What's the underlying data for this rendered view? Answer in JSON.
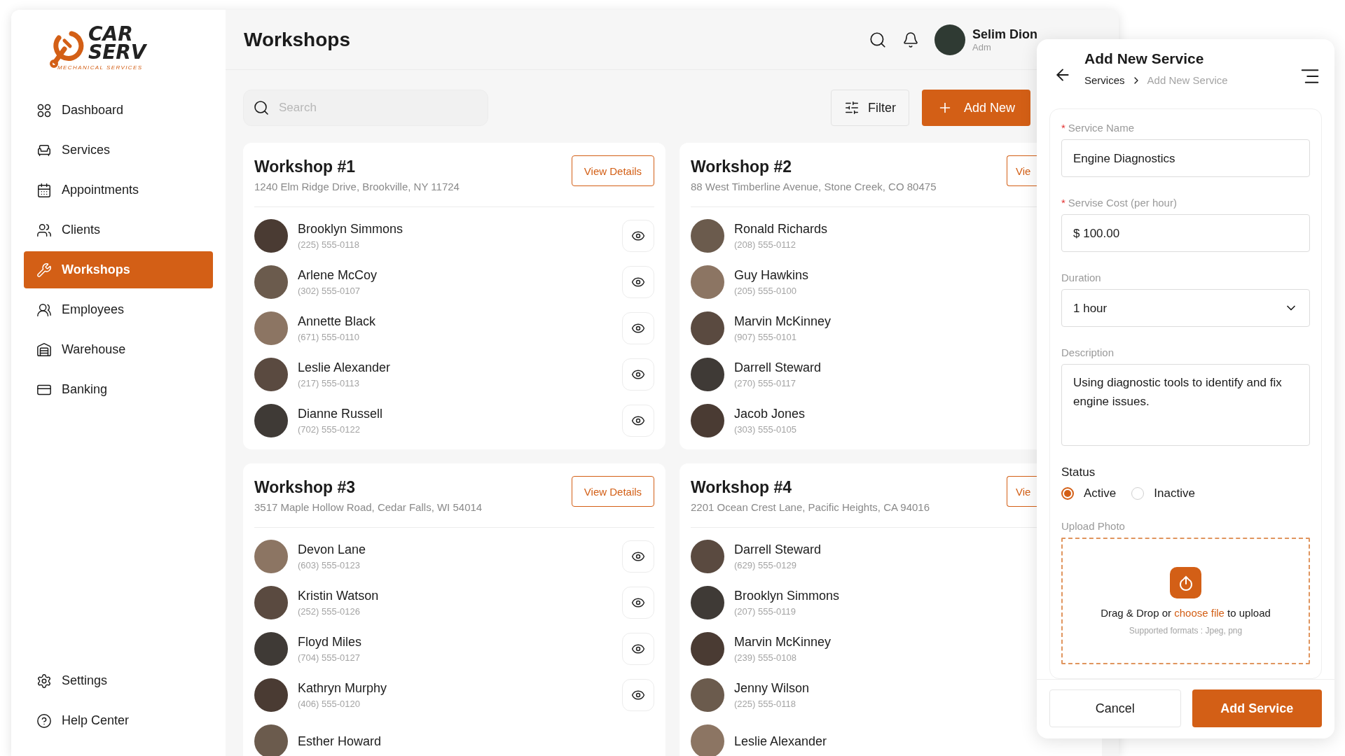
{
  "sidebar": {
    "logo": {
      "line1": "CAR",
      "line2": "SERV",
      "tagline": "MECHANICAL SERVICES"
    },
    "nav": [
      {
        "label": "Dashboard",
        "selected": false
      },
      {
        "label": "Services",
        "selected": false
      },
      {
        "label": "Appointments",
        "selected": false
      },
      {
        "label": "Clients",
        "selected": false
      },
      {
        "label": "Workshops",
        "selected": true
      },
      {
        "label": "Employees",
        "selected": false
      },
      {
        "label": "Warehouse",
        "selected": false
      },
      {
        "label": "Banking",
        "selected": false
      }
    ],
    "bottom": [
      {
        "label": "Settings"
      },
      {
        "label": "Help Center"
      }
    ]
  },
  "header": {
    "title": "Workshops",
    "user": {
      "name": "Selim Dion",
      "role": "Adm"
    }
  },
  "toolbar": {
    "search": {
      "placeholder": "Search"
    },
    "filter": "Filter",
    "add": "Add New"
  },
  "workshops": [
    {
      "name": "Workshop #1",
      "address": "1240 Elm Ridge Drive, Brookville, NY 11724",
      "view_button": "View Details",
      "clipped": false,
      "contacts": [
        {
          "name": "Brooklyn Simmons",
          "phone": "(225) 555-0118"
        },
        {
          "name": "Arlene McCoy",
          "phone": "(302) 555-0107"
        },
        {
          "name": "Annette Black",
          "phone": "(671) 555-0110"
        },
        {
          "name": "Leslie Alexander",
          "phone": "(217) 555-0113"
        },
        {
          "name": "Dianne Russell",
          "phone": "(702) 555-0122"
        }
      ]
    },
    {
      "name": "Workshop #2",
      "address": "88 West Timberline Avenue, Stone Creek, CO 80475",
      "view_button": "Vie",
      "clipped": true,
      "contacts": [
        {
          "name": "Ronald Richards",
          "phone": "(208) 555-0112"
        },
        {
          "name": "Guy Hawkins",
          "phone": "(205) 555-0100"
        },
        {
          "name": "Marvin McKinney",
          "phone": "(907) 555-0101"
        },
        {
          "name": "Darrell Steward",
          "phone": "(270) 555-0117"
        },
        {
          "name": "Jacob Jones",
          "phone": "(303) 555-0105"
        }
      ]
    },
    {
      "name": "Workshop #3",
      "address": "3517 Maple Hollow Road, Cedar Falls, WI 54014",
      "view_button": "View Details",
      "clipped": false,
      "contacts": [
        {
          "name": "Devon Lane",
          "phone": "(603) 555-0123"
        },
        {
          "name": "Kristin Watson",
          "phone": "(252) 555-0126"
        },
        {
          "name": "Floyd Miles",
          "phone": "(704) 555-0127"
        },
        {
          "name": "Kathryn Murphy",
          "phone": "(406) 555-0120"
        },
        {
          "name": "Esther Howard"
        }
      ]
    },
    {
      "name": "Workshop #4",
      "address": "2201 Ocean Crest Lane, Pacific Heights, CA 94016",
      "view_button": "Vie",
      "clipped": true,
      "contacts": [
        {
          "name": "Darrell Steward",
          "phone": "(629) 555-0129"
        },
        {
          "name": "Brooklyn Simmons",
          "phone": "(207) 555-0119"
        },
        {
          "name": "Marvin McKinney",
          "phone": "(239) 555-0108"
        },
        {
          "name": "Jenny Wilson",
          "phone": "(225) 555-0118"
        },
        {
          "name": "Leslie Alexander"
        }
      ]
    }
  ],
  "panel": {
    "title": "Add New Service",
    "breadcrumb": [
      {
        "label": "Services",
        "current": false
      },
      {
        "label": "Add New Service",
        "current": true
      }
    ],
    "fields": [
      {
        "kind": "text",
        "label": "Service Name",
        "required_mark": "*",
        "value": "Engine Diagnostics"
      },
      {
        "kind": "text",
        "label": "Servise Cost (per hour)",
        "required_mark": "*",
        "value": "$ 100.00"
      },
      {
        "kind": "select",
        "label": "Duration",
        "value": "1 hour"
      },
      {
        "kind": "textarea",
        "label": "Description",
        "value": "Using diagnostic tools to identify and fix engine issues."
      }
    ],
    "status": {
      "label": "Status",
      "options": [
        {
          "label": "Active",
          "selected": true
        },
        {
          "label": "Inactive",
          "selected": false
        }
      ]
    },
    "upload": {
      "label": "Upload Photo",
      "text": "Drag & Drop or",
      "link": "choose file",
      "after": "to upload",
      "formats": "Supported formats : Jpeg, png"
    },
    "buttons": {
      "cancel": "Cancel",
      "submit": "Add Service"
    }
  }
}
